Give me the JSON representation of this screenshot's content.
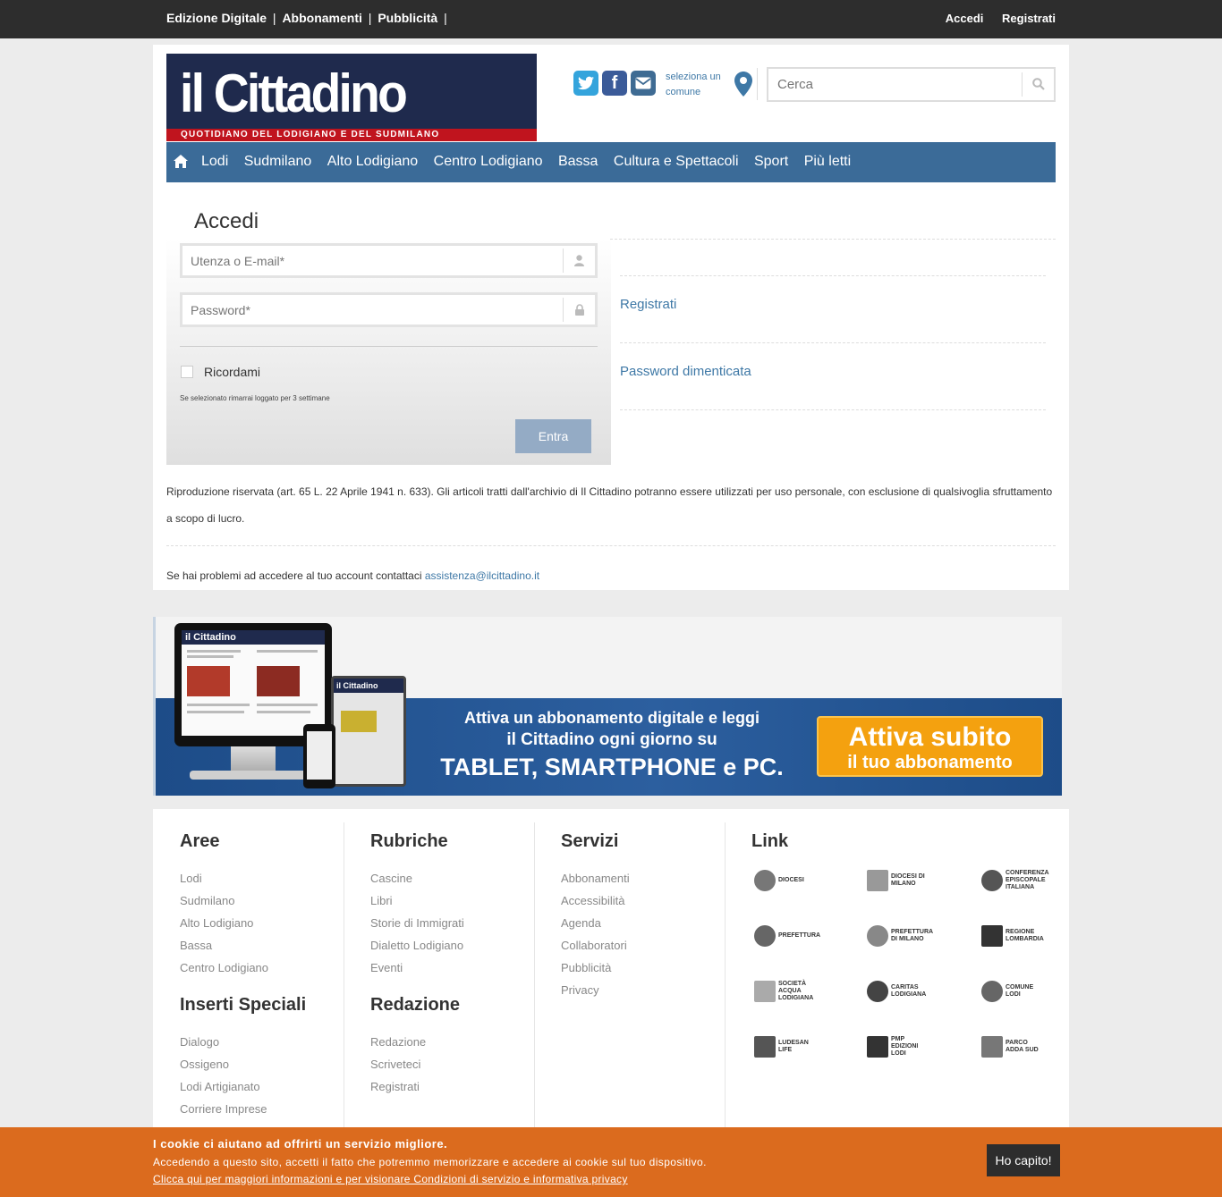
{
  "topbar": {
    "links": [
      "Edizione Digitale",
      "Abbonamenti",
      "Pubblicità"
    ],
    "login": "Accedi",
    "register": "Registrati"
  },
  "header": {
    "logo_name": "il Cittadino",
    "logo_tagline": "QUOTIDIANO DEL LODIGIANO E DEL SUDMILANO",
    "comune_link": "seleziona un comune",
    "search_placeholder": "Cerca"
  },
  "nav": {
    "items": [
      "Lodi",
      "Sudmilano",
      "Alto Lodigiano",
      "Centro Lodigiano",
      "Bassa",
      "Cultura e Spettacoli",
      "Sport",
      "Più letti"
    ]
  },
  "login": {
    "title": "Accedi",
    "user_placeholder": "Utenza o E-mail*",
    "password_placeholder": "Password*",
    "remember_label": "Ricordami",
    "remember_note": "Se selezionato rimarrai loggato per 3 settimane",
    "submit_label": "Entra",
    "register_link": "Registrati",
    "forgot_link": "Password dimenticata"
  },
  "notice": {
    "copyright": "Riproduzione riservata (art. 65 L. 22 Aprile 1941 n. 633). Gli articoli tratti dall'archivio di Il Cittadino potranno essere utilizzati per uso personale, con esclusione di qualsivoglia sfruttamento a scopo di lucro.",
    "help_text": "Se hai problemi ad accedere al tuo account contattaci",
    "help_email": "assistenza@ilcittadino.it"
  },
  "banner": {
    "screen_logo": "il Cittadino",
    "line1": "Attiva un abbonamento digitale e leggi",
    "line2": "il Cittadino ogni giorno su",
    "line3": "TABLET, SMARTPHONE e PC.",
    "cta_line1": "Attiva subito",
    "cta_line2": "il tuo abbonamento"
  },
  "footer": {
    "aree": {
      "title": "Aree",
      "links": [
        "Lodi",
        "Sudmilano",
        "Alto Lodigiano",
        "Bassa",
        "Centro Lodigiano"
      ]
    },
    "inserti": {
      "title": "Inserti Speciali",
      "links": [
        "Dialogo",
        "Ossigeno",
        "Lodi Artigianato",
        "Corriere Imprese"
      ]
    },
    "rubriche": {
      "title": "Rubriche",
      "links": [
        "Cascine",
        "Libri",
        "Storie di Immigrati",
        "Dialetto Lodigiano",
        "Eventi"
      ]
    },
    "redazione": {
      "title": "Redazione",
      "links": [
        "Redazione",
        "Scriveteci",
        "Registrati"
      ]
    },
    "servizi": {
      "title": "Servizi",
      "links": [
        "Abbonamenti",
        "Accessibilità",
        "Agenda",
        "Collaboratori",
        "Pubblicità",
        "Privacy"
      ]
    },
    "link": {
      "title": "Link",
      "logos": [
        "Diocesi",
        "Diocesi di Milano",
        "Conferenza Episcopale Italiana",
        "Prefettura",
        "Prefettura di Milano",
        "Regione Lombardia",
        "Società Acqua Lodigiana",
        "Caritas Lodigiana",
        "Comune Lodi",
        "Ludesan Life",
        "PMP Edizioni Lodi",
        "Parco Adda Sud"
      ]
    }
  },
  "cookie": {
    "title": "I cookie ci aiutano ad offrirti un servizio migliore.",
    "text": "Accedendo a questo sito, accetti il fatto che potremmo memorizzare e accedere ai cookie sul tuo dispositivo.",
    "link": "Clicca qui per maggiori informazioni e per visionare Condizioni di servizio e informativa privacy",
    "button": "Ho capito!"
  },
  "colors": {
    "nav_bg": "#3b6b98",
    "link": "#3e78a6",
    "cookie_bg": "#db6b1e",
    "cta": "#f4a10f"
  }
}
